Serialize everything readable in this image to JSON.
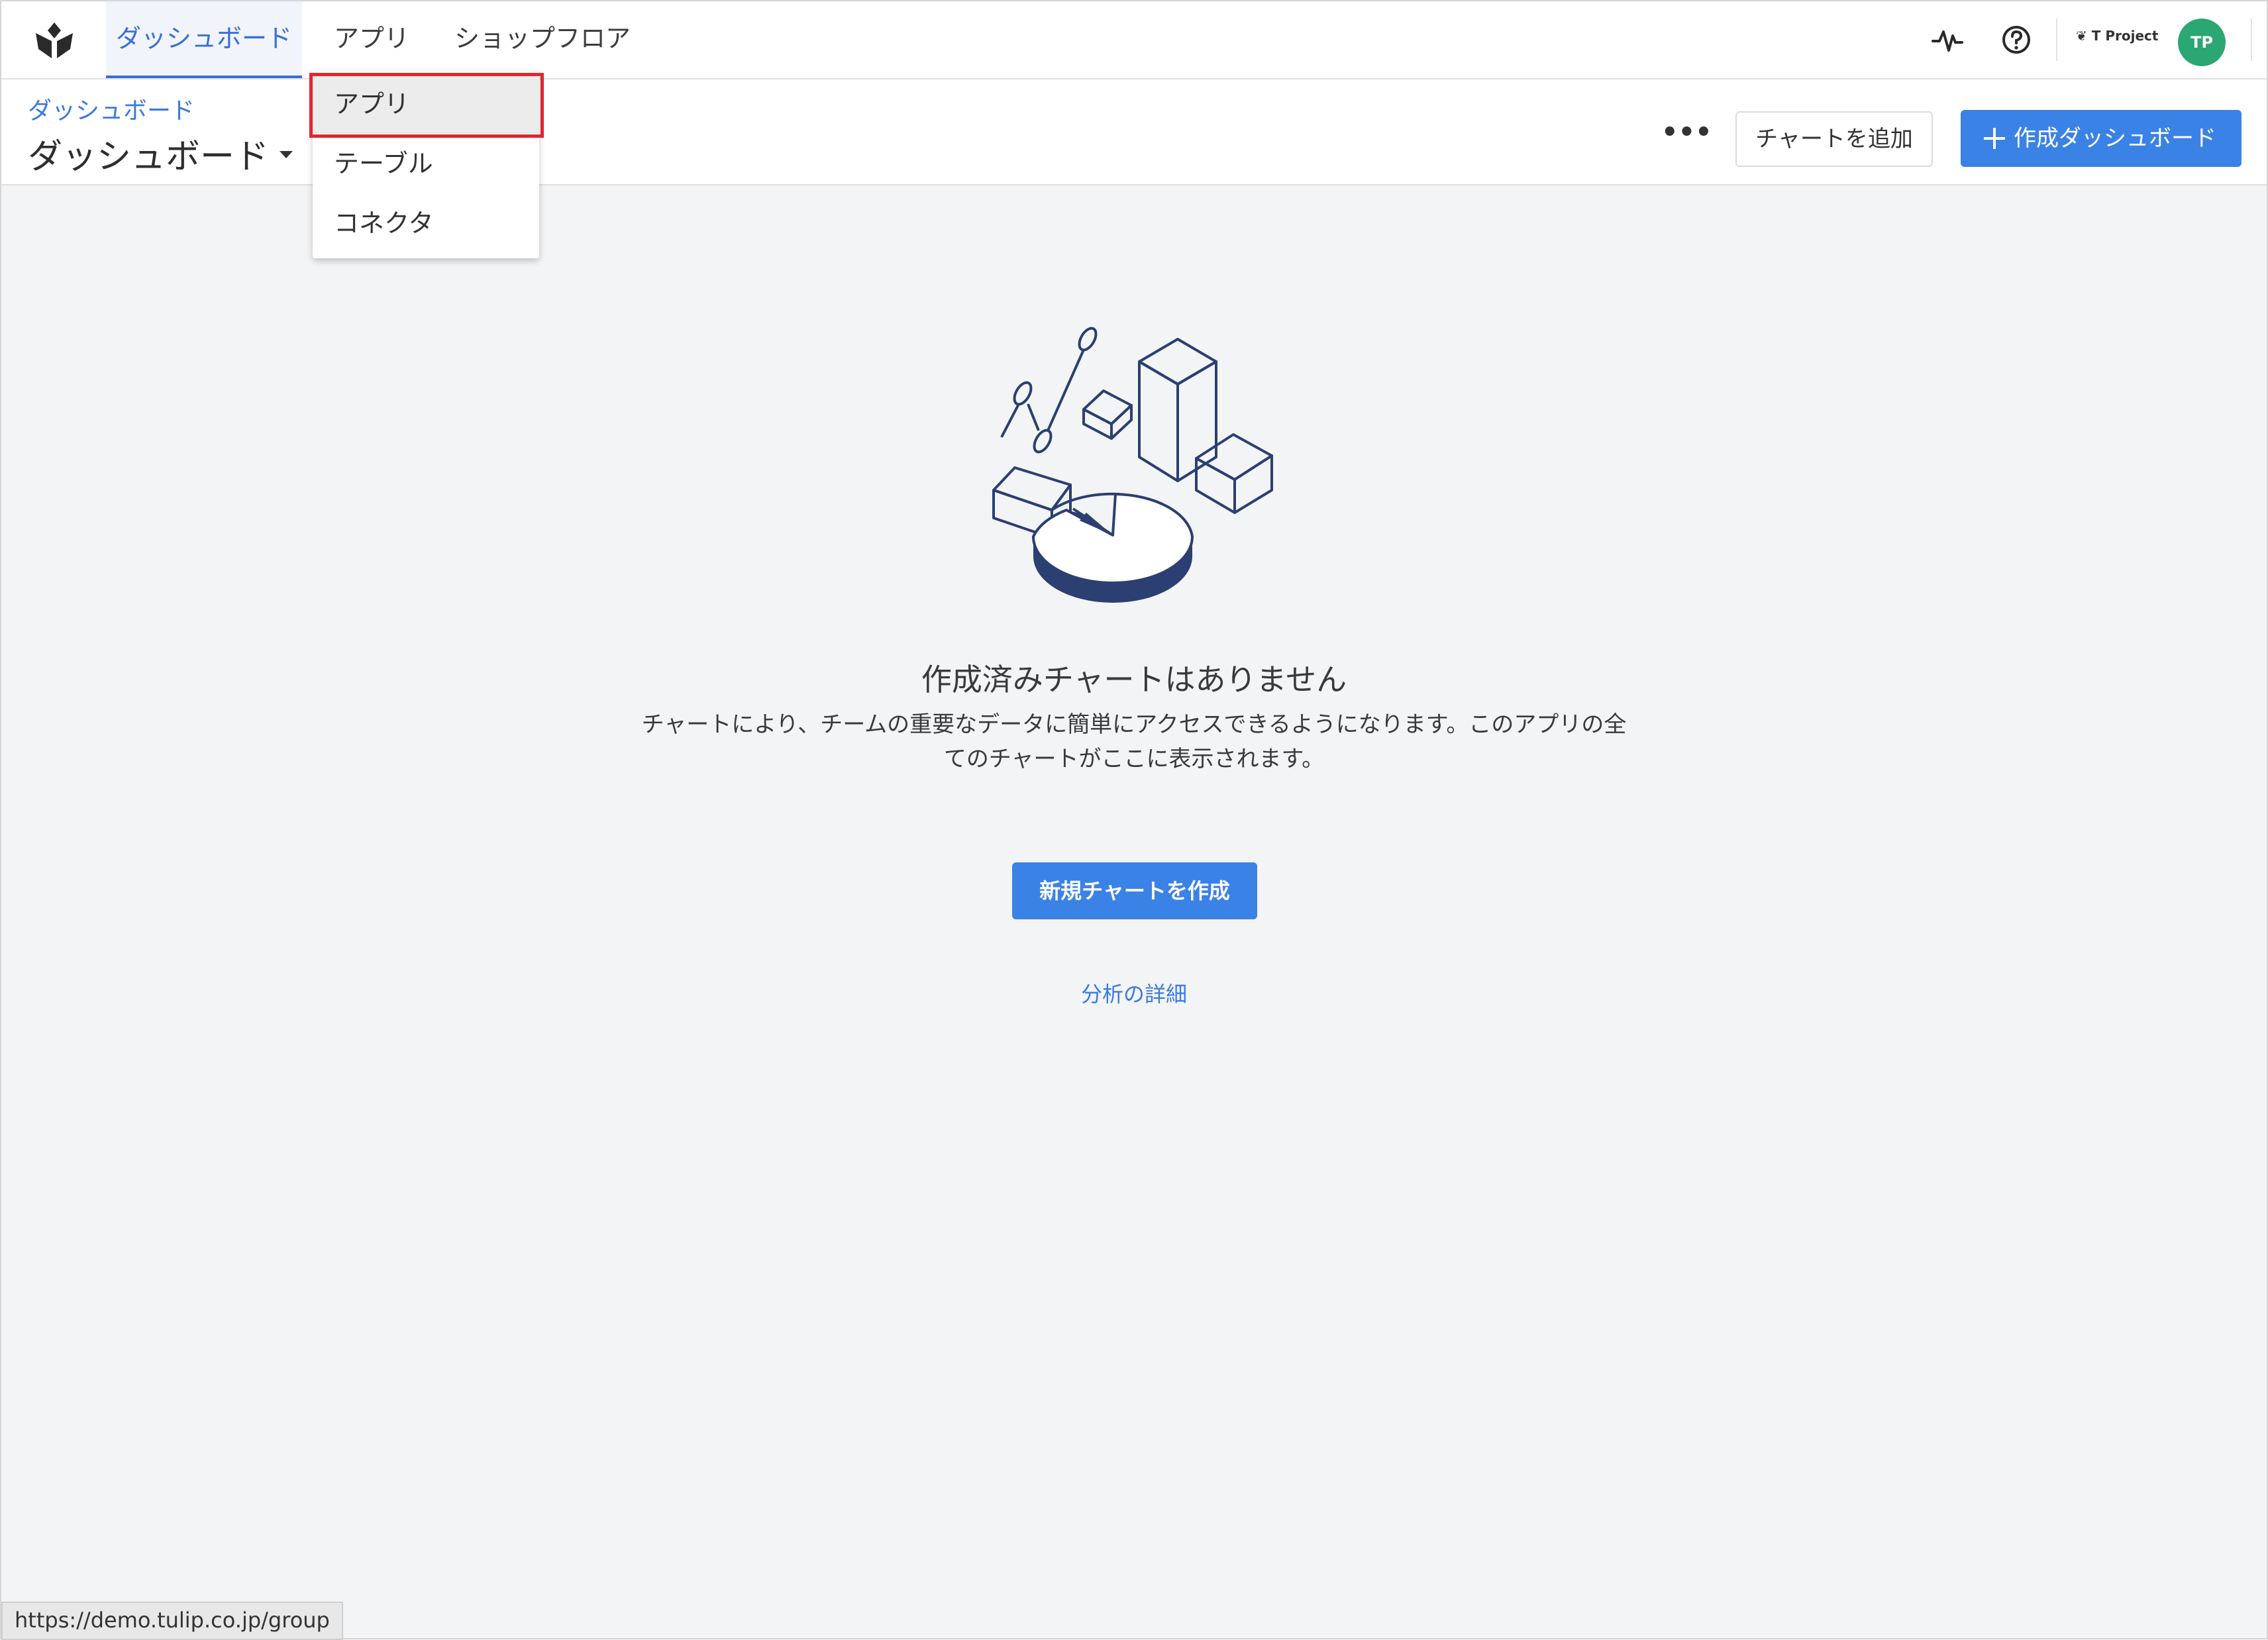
{
  "nav": {
    "tabs": [
      {
        "label": "ダッシュボード",
        "active": true
      },
      {
        "label": "アプリ",
        "active": false
      },
      {
        "label": "ショップフロア",
        "active": false
      }
    ],
    "icons": [
      "tulip-logo-icon",
      "activity-icon",
      "help-icon"
    ],
    "project_logo_text": "T Project",
    "avatar_initials": "TP",
    "accent_color": "#3a6fd8"
  },
  "dropdown": {
    "items": [
      {
        "label": "アプリ",
        "highlighted": true
      },
      {
        "label": "テーブル",
        "highlighted": false
      },
      {
        "label": "コネクタ",
        "highlighted": false
      }
    ]
  },
  "subheader": {
    "breadcrumb": "ダッシュボード",
    "title": "ダッシュボード",
    "more_label": "•••",
    "add_chart_label": "チャートを追加",
    "create_dashboard_label": "作成ダッシュボード"
  },
  "empty_state": {
    "title": "作成済みチャートはありません",
    "description": "チャートにより、チームの重要なデータに簡単にアクセスできるようになります。このアプリの全てのチャートがここに表示されます。",
    "create_button_label": "新規チャートを作成",
    "learn_more_label": "分析の詳細"
  },
  "status_bar": {
    "url": "https://demo.tulip.co.jp/group"
  }
}
